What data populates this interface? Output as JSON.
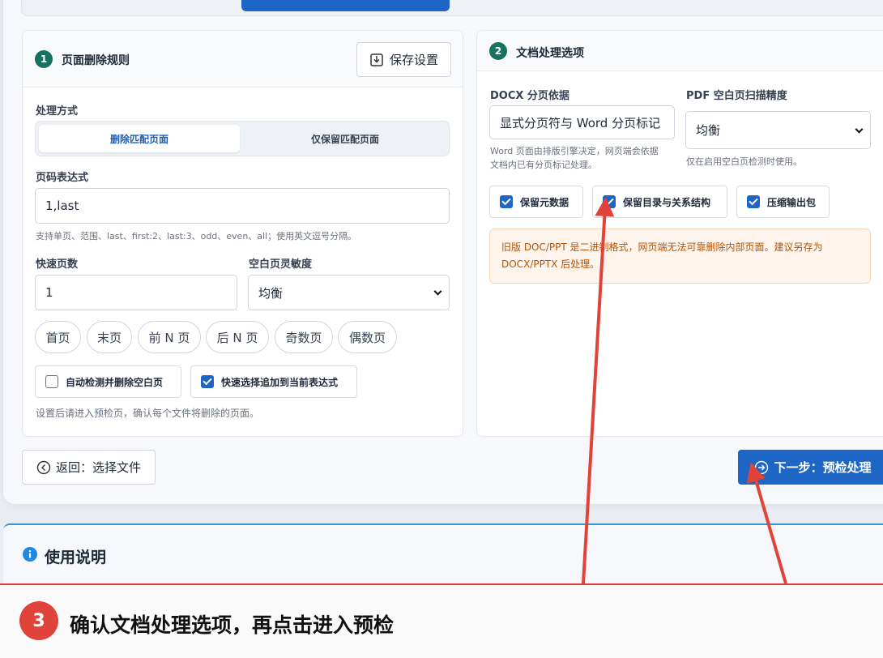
{
  "left_panel": {
    "badge": "1",
    "title": "页面删除规则",
    "save_button": "保存设置",
    "mode_label": "处理方式",
    "mode_options": [
      "删除匹配页面",
      "仅保留匹配页面"
    ],
    "expr_label": "页码表达式",
    "expr_value": "1,last",
    "expr_hint": "支持单页、范围、last、first:2、last:3、odd、even、all；使用英文逗号分隔。",
    "quick_count_label": "快速页数",
    "quick_count_value": "1",
    "sensitivity_label": "空白页灵敏度",
    "sensitivity_value": "均衡",
    "quick_pills": [
      "首页",
      "末页",
      "前 N 页",
      "后 N 页",
      "奇数页",
      "偶数页"
    ],
    "check_auto_blank": "自动检测并删除空白页",
    "check_append": "快速选择追加到当前表达式",
    "footer_hint": "设置后请进入预检页，确认每个文件将删除的页面。"
  },
  "right_panel": {
    "badge": "2",
    "title": "文档处理选项",
    "docx_label": "DOCX 分页依据",
    "docx_value": "显式分页符与 Word 分页标记",
    "docx_hint_1": "Word 页面由排版引擎决定，网页端会依据",
    "docx_hint_2": "文档内已有分页标记处理。",
    "pdf_label": "PDF 空白页扫描精度",
    "pdf_value": "均衡",
    "pdf_hint": "仅在启用空白页检测时使用。",
    "check_metadata": "保留元数据",
    "check_toc": "保留目录与关系结构",
    "check_zip": "压缩输出包",
    "warn_line_1": "旧版 DOC/PPT 是二进制格式，网页端无法可靠删除内部页面。建议另存为",
    "warn_line_2": "DOCX/PPTX 后处理。"
  },
  "nav": {
    "back": "返回：选择文件",
    "next": "下一步：预检处理"
  },
  "usage": {
    "title": "使用说明"
  },
  "annotation": {
    "step": "3",
    "text": "确认文档处理选项，再点击进入预检"
  },
  "colors": {
    "accent": "#1e66c5",
    "badge": "#16735f",
    "annotation": "#e0433a",
    "warning": "#b45309"
  }
}
